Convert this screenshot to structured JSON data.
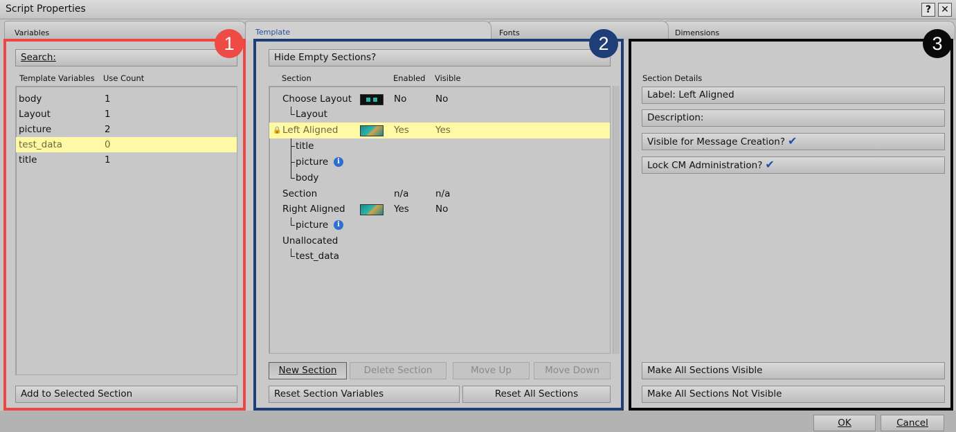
{
  "window": {
    "title": "Script Properties",
    "help_button": "?",
    "close_button": "✕"
  },
  "tabs": [
    {
      "label": "Variables"
    },
    {
      "label": "Template"
    },
    {
      "label": "Fonts"
    },
    {
      "label": "Dimensions"
    }
  ],
  "callouts": [
    "1",
    "2",
    "3"
  ],
  "variables_panel": {
    "search_label": "Search:",
    "col_variable": "Template Variables",
    "col_count": "Use Count",
    "rows": [
      {
        "name": "body",
        "count": "1"
      },
      {
        "name": "Layout",
        "count": "1"
      },
      {
        "name": "picture",
        "count": "2"
      },
      {
        "name": "test_data",
        "count": "0",
        "selected": true
      },
      {
        "name": "title",
        "count": "1"
      }
    ],
    "add_button": "Add to Selected Section"
  },
  "template_panel": {
    "hide_empty_label": "Hide Empty Sections?",
    "col_section": "Section",
    "col_enabled": "Enabled",
    "col_visible": "Visible",
    "rows": [
      {
        "label": "Choose Layout",
        "enabled": "No",
        "visible": "No"
      },
      {
        "label": "Layout"
      },
      {
        "label": "Left Aligned",
        "enabled": "Yes",
        "visible": "Yes",
        "selected": true
      },
      {
        "label": "title"
      },
      {
        "label": "picture"
      },
      {
        "label": "body"
      },
      {
        "label": "Section",
        "enabled": "n/a",
        "visible": "n/a"
      },
      {
        "label": "Right Aligned",
        "enabled": "Yes",
        "visible": "No"
      },
      {
        "label": "picture"
      },
      {
        "label": "Unallocated"
      },
      {
        "label": "test_data"
      }
    ],
    "new_section": "New Section",
    "delete_section": "Delete Section",
    "move_up": "Move Up",
    "move_down": "Move Down",
    "reset_vars": "Reset Section Variables",
    "reset_all": "Reset All Sections"
  },
  "details_panel": {
    "heading": "Section Details",
    "label_field": "Label:  Left Aligned",
    "description_field": "Description:",
    "visible_creation": "Visible for Message Creation?",
    "lock_admin": "Lock CM Administration?",
    "make_visible": "Make All Sections Visible",
    "make_not_visible": "Make All Sections Not Visible"
  },
  "footer": {
    "ok": "OK",
    "cancel": "Cancel"
  },
  "colors": {
    "outline_1": "#f04545",
    "outline_2": "#1f3e78",
    "outline_3": "#0a0a0a",
    "badge_1": "#ee4b45",
    "badge_2": "#1f3e78",
    "badge_3": "#0a0a0a",
    "selection": "#fff9a5"
  }
}
